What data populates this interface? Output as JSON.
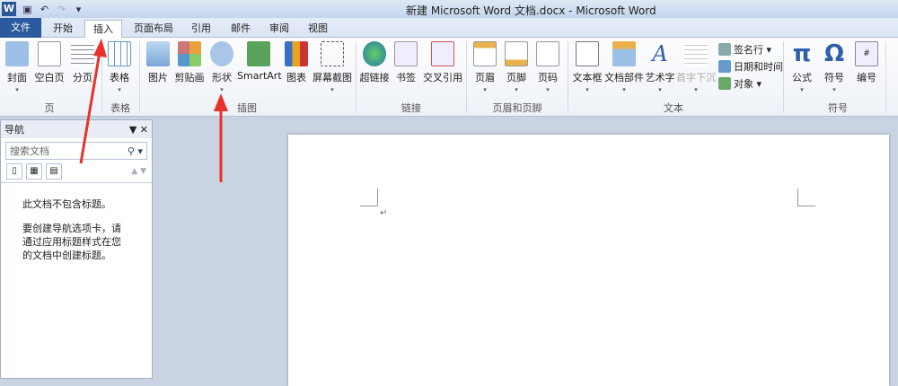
{
  "window": {
    "title": "新建 Microsoft Word 文档.docx - Microsoft Word",
    "app_icon": "W"
  },
  "tabs": [
    "文件",
    "开始",
    "插入",
    "页面布局",
    "引用",
    "邮件",
    "审阅",
    "视图"
  ],
  "ribbon": {
    "buttons": [
      {
        "label": "封面",
        "dd": "▾"
      },
      {
        "label": "空白页"
      },
      {
        "label": "分页"
      },
      {
        "label": "表格",
        "dd": "▾"
      },
      {
        "label": "图片"
      },
      {
        "label": "剪贴画"
      },
      {
        "label": "形状",
        "dd": "▾"
      },
      {
        "label": "SmartArt"
      },
      {
        "label": "图表"
      },
      {
        "label": "屏幕截图",
        "dd": "▾"
      },
      {
        "label": "超链接"
      },
      {
        "label": "书签"
      },
      {
        "label": "交叉引用"
      },
      {
        "label": "页眉",
        "dd": "▾"
      },
      {
        "label": "页脚",
        "dd": "▾"
      },
      {
        "label": "页码",
        "dd": "▾"
      },
      {
        "label": "文本框",
        "dd": "▾"
      },
      {
        "label": "文档部件",
        "dd": "▾"
      },
      {
        "label": "艺术字",
        "dd": "▾"
      },
      {
        "label": "首字下沉",
        "dd": "▾"
      },
      {
        "label": "公式",
        "dd": "▾"
      },
      {
        "label": "符号",
        "dd": "▾"
      },
      {
        "label": "编号"
      }
    ],
    "small_buttons": [
      "签名行 ▾",
      "日期和时间",
      "对象 ▾"
    ],
    "groups": [
      "页",
      "表格",
      "插图",
      "链接",
      "页眉和页脚",
      "文本",
      "符号"
    ]
  },
  "nav": {
    "title": "导航",
    "search_placeholder": "搜索文档",
    "message1": "此文档不包含标题。",
    "message2": "要创建导航选项卡，请通过应用标题样式在您的文档中创建标题。"
  },
  "document": {
    "paragraph_mark": "↵"
  }
}
